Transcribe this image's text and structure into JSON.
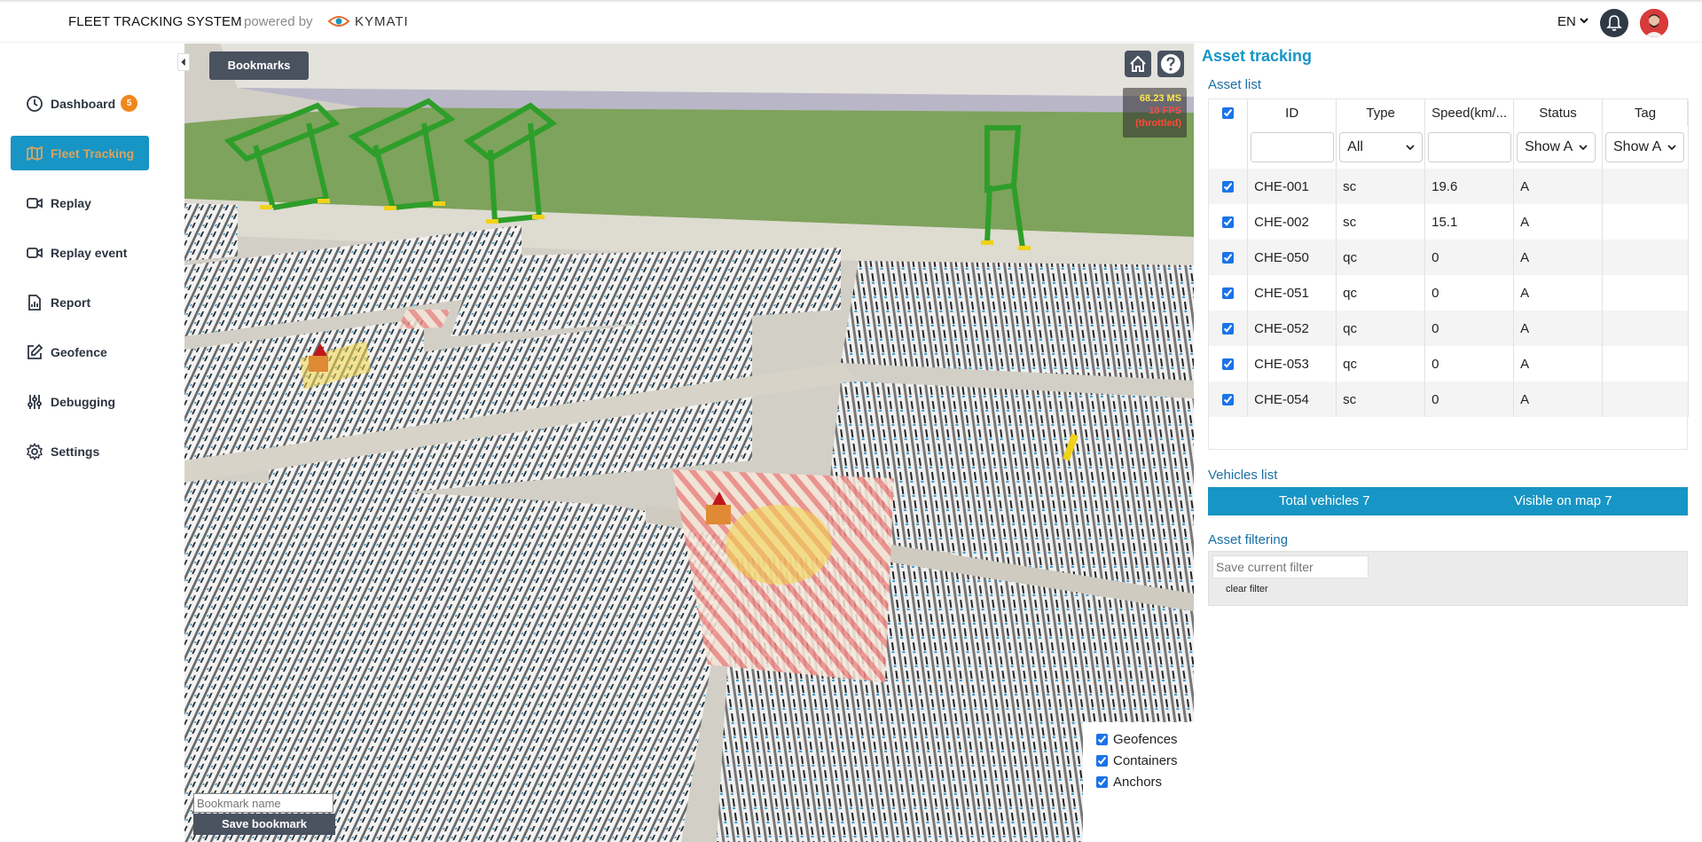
{
  "header": {
    "brand": "FLEET TRACKING SYSTEM",
    "powered_by": "powered by",
    "logo_text": "KYMATI",
    "language": "EN",
    "icons": [
      "eye-logo-icon",
      "chevron-down-icon",
      "bell-icon",
      "user-avatar"
    ]
  },
  "sidebar": {
    "items": [
      {
        "label": "Dashboard",
        "icon": "clock-icon",
        "badge": "5",
        "active": false
      },
      {
        "label": "Fleet Tracking",
        "icon": "map-icon",
        "active": true
      },
      {
        "label": "Replay",
        "icon": "video-icon",
        "active": false
      },
      {
        "label": "Replay event",
        "icon": "video-icon",
        "active": false
      },
      {
        "label": "Report",
        "icon": "report-icon",
        "active": false
      },
      {
        "label": "Geofence",
        "icon": "edit-icon",
        "active": false
      },
      {
        "label": "Debugging",
        "icon": "sliders-icon",
        "active": false
      },
      {
        "label": "Settings",
        "icon": "gear-icon",
        "active": false
      }
    ]
  },
  "map": {
    "bookmarks_label": "Bookmarks",
    "fps": {
      "ms": "68.23 MS",
      "fps": "10 FPS",
      "throttled": "(throttled)"
    },
    "layers": [
      {
        "label": "Geofences",
        "checked": true
      },
      {
        "label": "Containers",
        "checked": true
      },
      {
        "label": "Anchors",
        "checked": true
      }
    ],
    "bookmark_placeholder": "Bookmark name",
    "save_bookmark_label": "Save bookmark",
    "colors": {
      "crane": "#2e9e2a",
      "geofence_stripe": "#ee8a86",
      "ground": "#cfcfc7",
      "grass": "#7ea35c"
    }
  },
  "panel": {
    "title": "Asset tracking",
    "asset_list_label": "Asset list",
    "columns": [
      "ID",
      "Type",
      "Speed(km/...",
      "Status",
      "Tag"
    ],
    "filters": {
      "type": "All",
      "status": "Show A",
      "tag": "Show A"
    },
    "rows": [
      {
        "id": "CHE-001",
        "type": "sc",
        "speed": "19.6",
        "status": "A",
        "tag": "",
        "checked": true
      },
      {
        "id": "CHE-002",
        "type": "sc",
        "speed": "15.1",
        "status": "A",
        "tag": "",
        "checked": true
      },
      {
        "id": "CHE-050",
        "type": "qc",
        "speed": "0",
        "status": "A",
        "tag": "",
        "checked": true
      },
      {
        "id": "CHE-051",
        "type": "qc",
        "speed": "0",
        "status": "A",
        "tag": "",
        "checked": true
      },
      {
        "id": "CHE-052",
        "type": "qc",
        "speed": "0",
        "status": "A",
        "tag": "",
        "checked": true
      },
      {
        "id": "CHE-053",
        "type": "qc",
        "speed": "0",
        "status": "A",
        "tag": "",
        "checked": true
      },
      {
        "id": "CHE-054",
        "type": "sc",
        "speed": "0",
        "status": "A",
        "tag": "",
        "checked": true
      }
    ],
    "vehicles_list_label": "Vehicles list",
    "total_vehicles": "Total vehicles 7",
    "visible_on_map": "Visible on map 7",
    "asset_filtering_label": "Asset filtering",
    "save_filter_placeholder": "Save current filter",
    "clear_filter_label": "clear filter",
    "accent": "#1795c4"
  }
}
